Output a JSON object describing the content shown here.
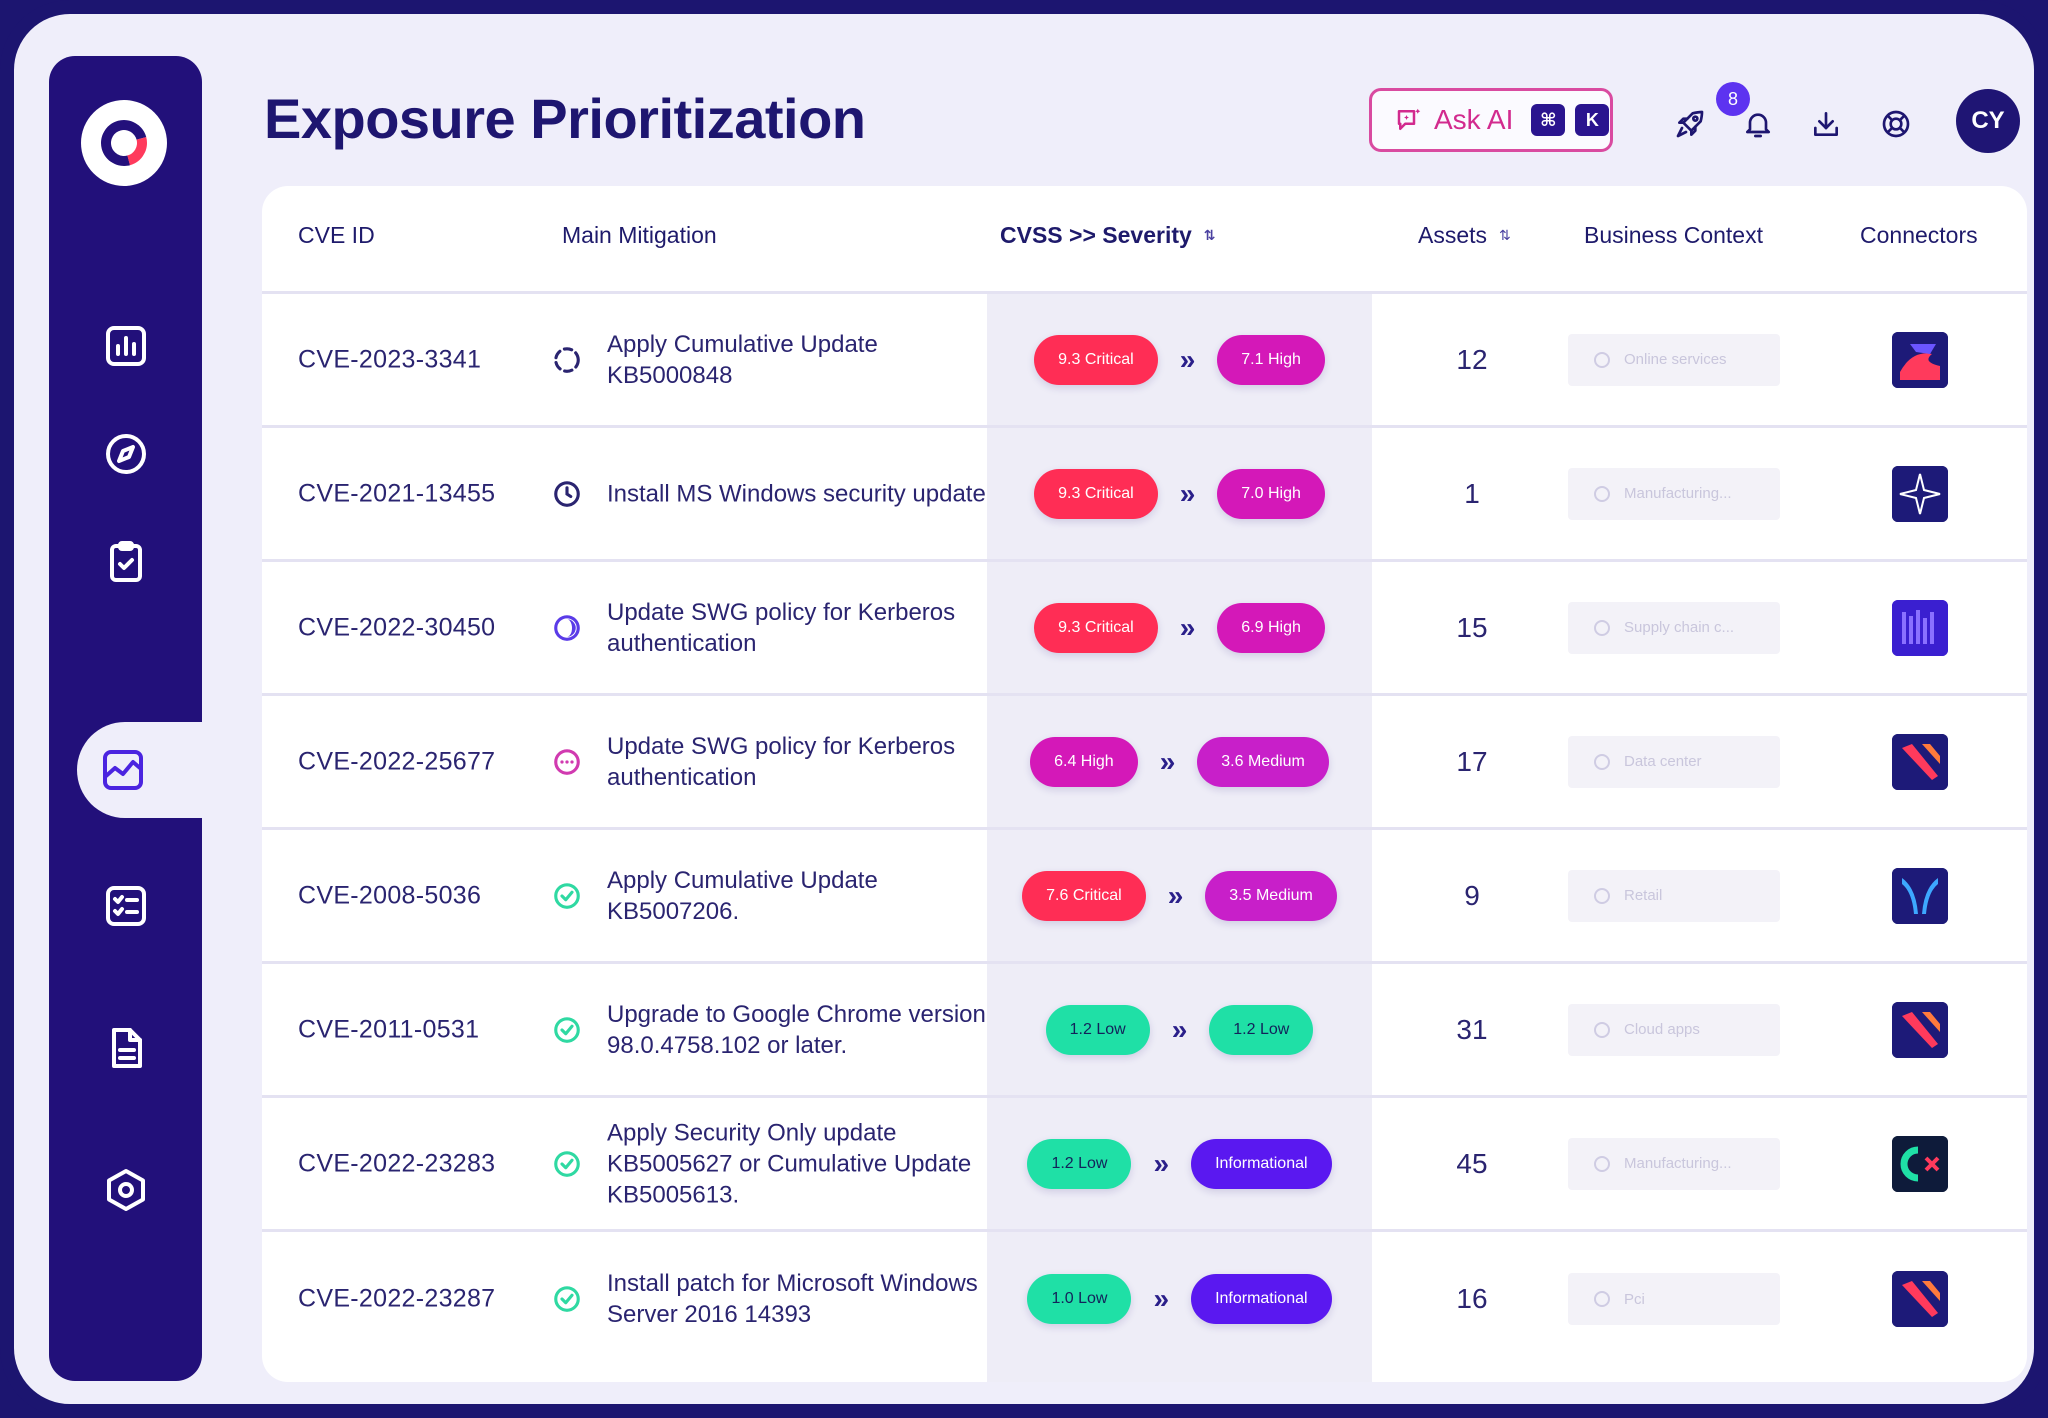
{
  "page": {
    "title": "Exposure Prioritization"
  },
  "header": {
    "ask_ai_label": "Ask AI",
    "ask_ai_key1": "⌘",
    "ask_ai_key2": "K",
    "notifications_count": "8",
    "avatar_initials": "CY"
  },
  "sidebar": {
    "items": [
      {
        "name": "analytics",
        "icon": "bar-chart-icon"
      },
      {
        "name": "explore",
        "icon": "compass-icon"
      },
      {
        "name": "tasks",
        "icon": "clipboard-check-icon"
      },
      {
        "name": "exposure",
        "icon": "line-chart-icon",
        "active": true
      },
      {
        "name": "checklist",
        "icon": "checklist-icon"
      },
      {
        "name": "reports",
        "icon": "document-icon"
      },
      {
        "name": "settings",
        "icon": "hexagon-settings-icon"
      }
    ]
  },
  "table": {
    "columns": {
      "cve_id": "CVE ID",
      "main_mitigation": "Main Mitigation",
      "severity": "CVSS >> Severity",
      "assets": "Assets",
      "business_context": "Business Context",
      "connectors": "Connectors"
    },
    "rows": [
      {
        "cve": "CVE-2023-3341",
        "mitigation": "Apply Cumulative Update KB5000848",
        "status_icon": "loading-circle-icon",
        "cvss": "9.3 Critical",
        "severity": "7.1 High",
        "assets": "12",
        "context": "Online services"
      },
      {
        "cve": "CVE-2021-13455",
        "mitigation": "Install MS Windows security update",
        "status_icon": "clock-icon",
        "cvss": "9.3 Critical",
        "severity": "7.0 High",
        "assets": "1",
        "context": "Manufacturing..."
      },
      {
        "cve": "CVE-2022-30450",
        "mitigation": "Update SWG policy for Kerberos authentication",
        "status_icon": "half-moon-icon",
        "cvss": "9.3 Critical",
        "severity": "6.9 High",
        "assets": "15",
        "context": "Supply chain c..."
      },
      {
        "cve": "CVE-2022-25677",
        "mitigation": "Update SWG policy for Kerberos authentication",
        "status_icon": "ellipsis-circle-icon",
        "cvss": "6.4 High",
        "severity": "3.6 Medium",
        "assets": "17",
        "context": "Data center"
      },
      {
        "cve": "CVE-2008-5036",
        "mitigation": "Apply Cumulative Update KB5007206.",
        "status_icon": "check-circle-icon",
        "cvss": "7.6 Critical",
        "severity": "3.5 Medium",
        "assets": "9",
        "context": "Retail"
      },
      {
        "cve": "CVE-2011-0531",
        "mitigation": "Upgrade to Google Chrome version 98.0.4758.102 or later.",
        "status_icon": "check-circle-icon",
        "cvss": "1.2 Low",
        "severity": "1.2 Low",
        "assets": "31",
        "context": "Cloud apps"
      },
      {
        "cve": "CVE-2022-23283",
        "mitigation": "Apply Security Only update KB5005627 or Cumulative Update KB5005613.",
        "status_icon": "check-circle-icon",
        "cvss": "1.2 Low",
        "severity": "Informational",
        "assets": "45",
        "context": "Manufacturing..."
      },
      {
        "cve": "CVE-2022-23287",
        "mitigation": "Install patch for Microsoft Windows Server 2016 14393",
        "status_icon": "check-circle-icon",
        "cvss": "1.0 Low",
        "severity": "Informational",
        "assets": "16",
        "context": "Pci"
      }
    ]
  },
  "colors": {
    "critical": "#ff2d55",
    "high": "#d418b8",
    "medium": "#c81fc9",
    "low": "#1fe0a6",
    "informational": "#5a18f0",
    "brand": "#22107a"
  }
}
